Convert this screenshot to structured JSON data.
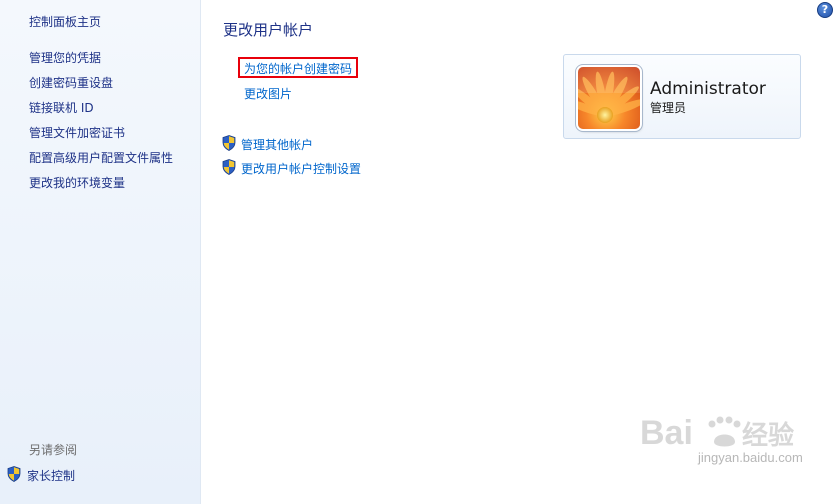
{
  "sidebar": {
    "items": [
      {
        "label": "控制面板主页"
      },
      {
        "label": "管理您的凭据"
      },
      {
        "label": "创建密码重设盘"
      },
      {
        "label": "链接联机 ID"
      },
      {
        "label": "管理文件加密证书"
      },
      {
        "label": "配置高级用户配置文件属性"
      },
      {
        "label": "更改我的环境变量"
      }
    ],
    "see_also": "另请参阅",
    "family": "家长控制"
  },
  "main": {
    "title": "更改用户帐户",
    "create_password": "为您的帐户创建密码",
    "change_picture": "更改图片",
    "manage_other": "管理其他帐户",
    "uac_settings": "更改用户帐户控制设置"
  },
  "user": {
    "name": "Administrator",
    "role": "管理员"
  },
  "help": "?",
  "watermark": {
    "text": "jingyan.baidu.com"
  },
  "colors": {
    "link": "#0066cc",
    "nav": "#1e3287",
    "highlight_border": "#e8000b"
  }
}
